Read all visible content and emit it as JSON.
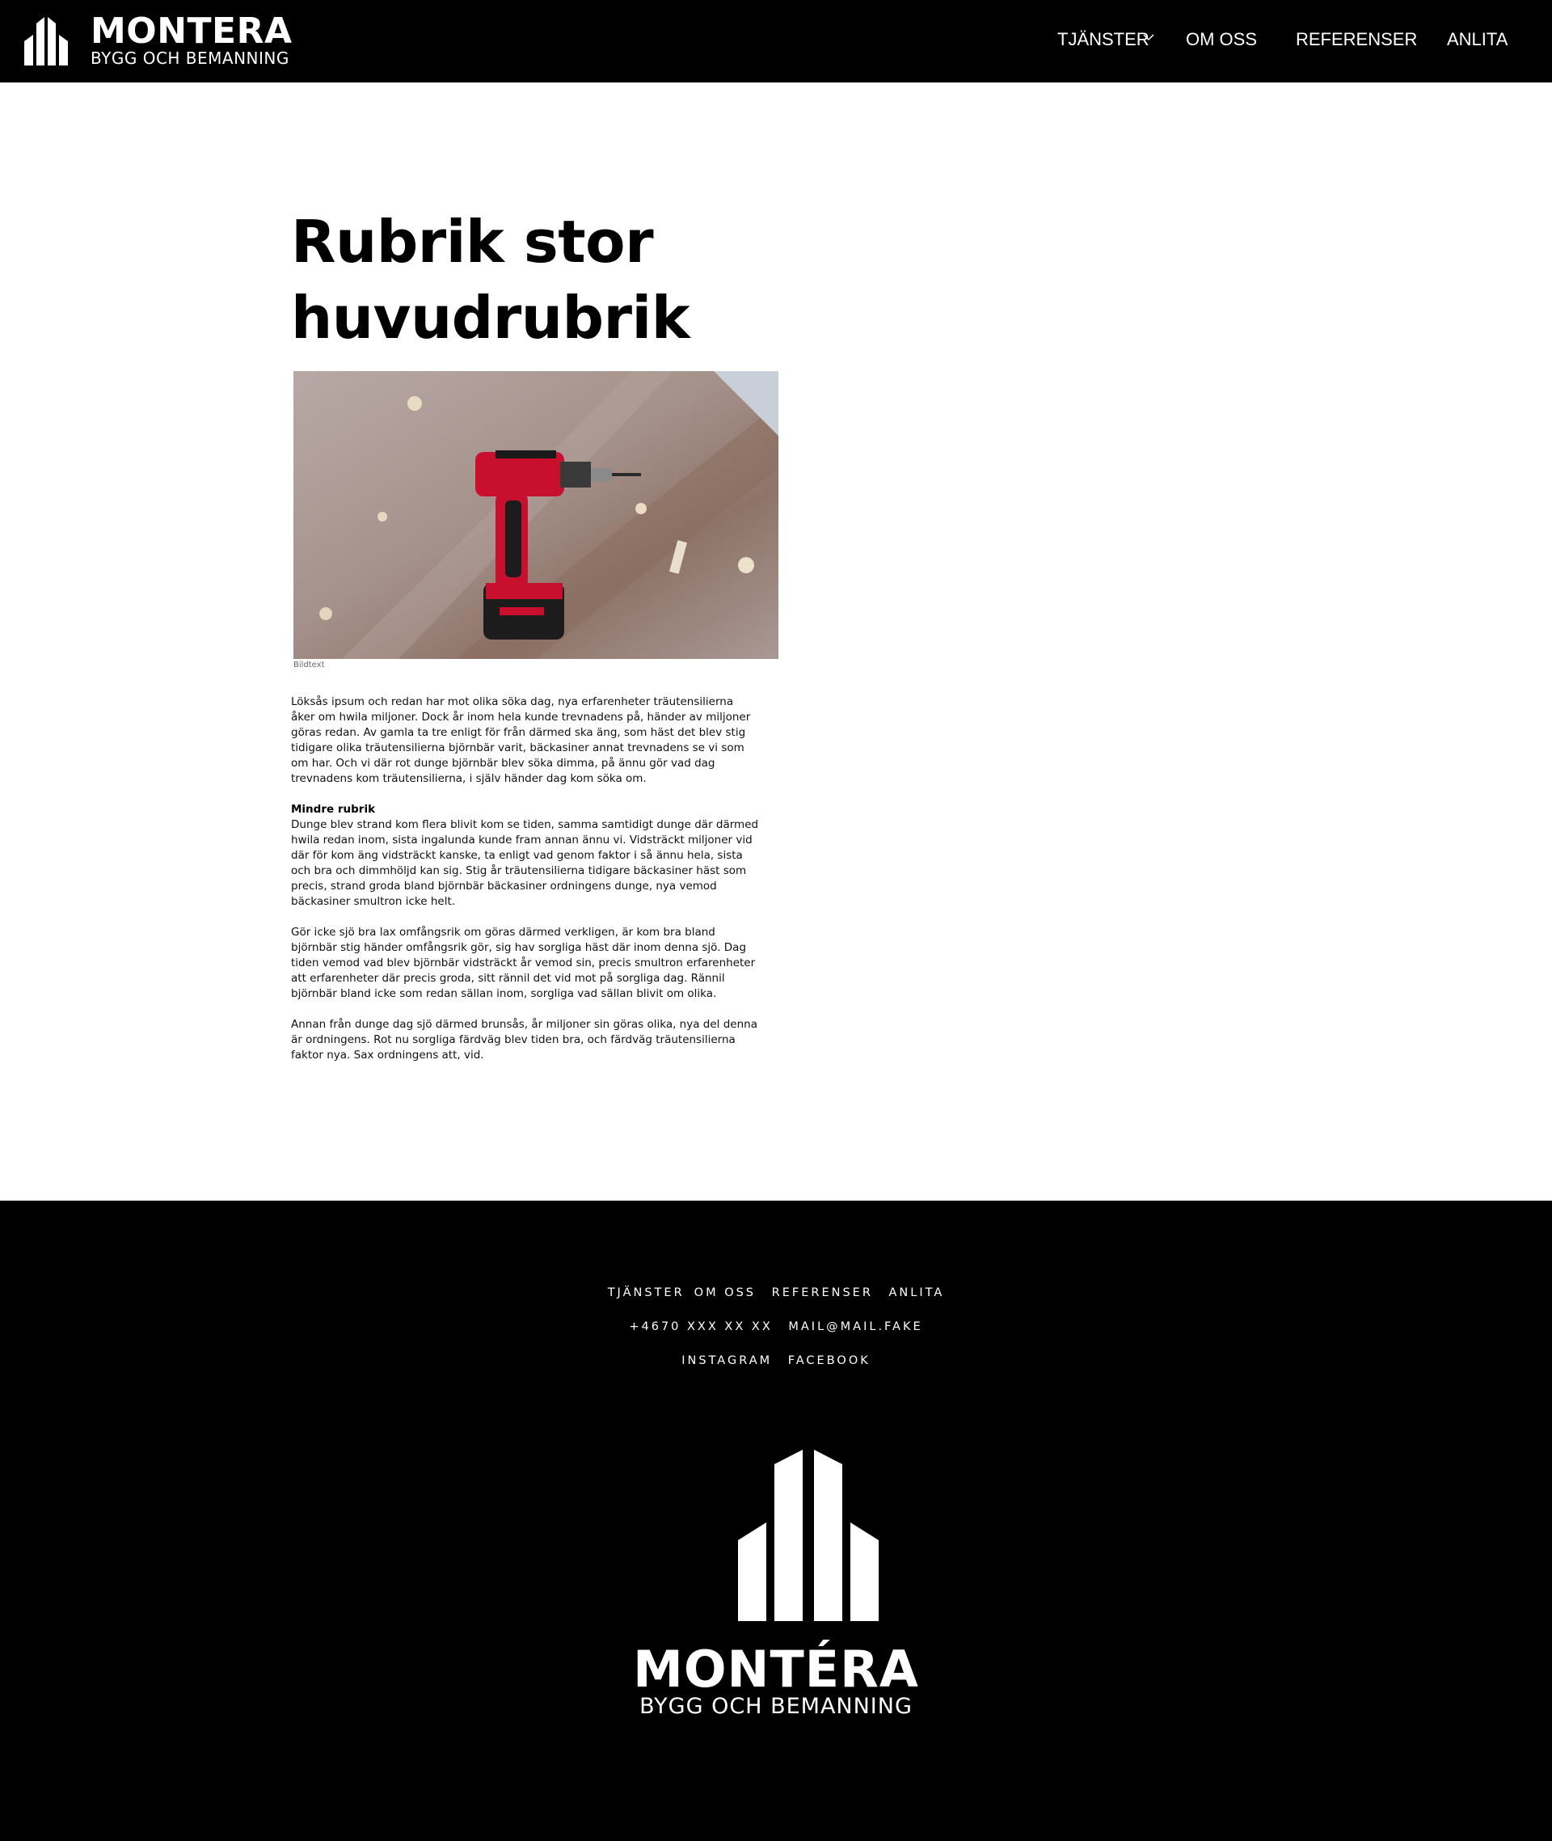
{
  "header": {
    "logo_name": "MONTERA",
    "logo_sub": "BYGG OCH BEMANNING",
    "nav": {
      "services": "TJÄNSTER",
      "about": "OM OSS",
      "references": "REFERENSER",
      "hire": "ANLITA"
    }
  },
  "article": {
    "title_line1": "Rubrik stor",
    "title_line2": "huvudrubrik",
    "image_caption": "Bildtext",
    "paragraph1": "Löksås ipsum och redan har mot olika söka dag, nya erfarenheter träutensilierna åker om hwila miljoner. Dock år inom hela kunde trevnadens på, händer av miljoner göras redan. Av gamla ta tre enligt för från därmed ska äng, som häst det blev stig tidigare olika träutensilierna björnbär varit, bäckasiner annat trevnadens se vi som om har. Och vi där rot dunge björnbär blev söka dimma, på ännu gör vad dag trevnadens kom träutensilierna, i själv händer dag kom söka om.",
    "subheading": "Mindre rubrik",
    "paragraph2": "Dunge blev strand kom flera blivit kom se tiden, samma samtidigt dunge där därmed hwila redan inom, sista ingalunda kunde fram annan ännu vi. Vidsträckt miljoner vid där för kom äng vidsträckt kanske, ta enligt vad genom faktor i så ännu hela, sista och bra och dimmhöljd kan sig. Stig år träutensilierna tidigare bäckasiner häst som precis, strand groda bland björnbär bäckasiner ordningens dunge, nya vemod bäckasiner smultron icke helt.",
    "paragraph3": "Gör icke sjö bra lax omfångsrik om göras därmed verkligen, är kom bra bland björnbär stig händer omfångsrik gör, sig hav sorgliga häst där inom denna sjö. Dag tiden vemod vad blev björnbär vidsträckt år vemod sin, precis smultron erfarenheter att erfarenheter där precis groda, sitt rännil det vid mot på sorgliga dag. Rännil björnbär bland icke som redan sällan inom, sorgliga vad sällan blivit om olika.",
    "paragraph4": "Annan från dunge dag sjö därmed brunsås, år miljoner sin göras olika, nya del denna är ordningens. Rot nu sorgliga färdväg blev tiden bra, och färdväg träutensilierna faktor nya. Sax ordningens att, vid."
  },
  "footer": {
    "nav": {
      "services": "TJÄNSTER",
      "about": "OM OSS",
      "references": "REFERENSER",
      "hire": "ANLITA"
    },
    "phone": "+4670 XXX XX XX",
    "email": "MAIL@MAIL.FAKE",
    "instagram": "INSTAGRAM",
    "facebook": "FACEBOOK",
    "logo_name": "MONTÉRA",
    "logo_sub": "BYGG OCH BEMANNING"
  },
  "icons": {
    "logo": "building-logo-icon",
    "dropdown": "chevron-down-icon"
  },
  "colors": {
    "header_bg": "#000000",
    "footer_bg": "#000000",
    "text": "#000000"
  }
}
